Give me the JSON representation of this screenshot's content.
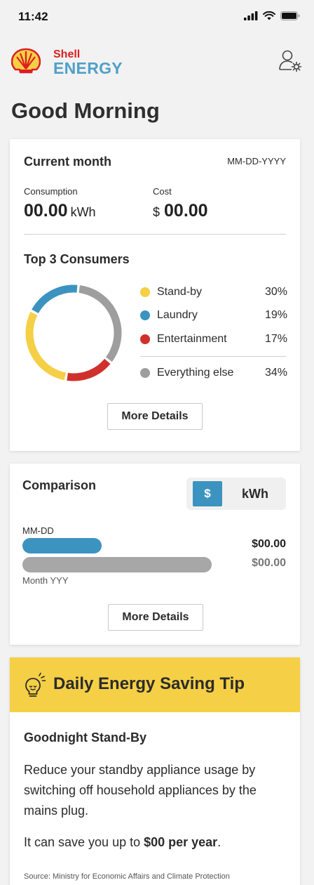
{
  "status_bar": {
    "time": "11:42"
  },
  "brand": {
    "top": "Shell",
    "bottom": "ENERGY",
    "primary_color": "#dd1d21",
    "accent_color": "#4fa0c9"
  },
  "greeting": "Good Morning",
  "current_month": {
    "title": "Current month",
    "date": "MM-DD-YYYY",
    "consumption_label": "Consumption",
    "consumption_value": "00.00",
    "consumption_unit": "kWh",
    "cost_label": "Cost",
    "cost_currency": "$",
    "cost_value": "00.00",
    "top_consumers_title": "Top 3 Consumers",
    "consumers": [
      {
        "label": "Stand-by",
        "percent": "30%",
        "value": 30,
        "color": "#f5cf45"
      },
      {
        "label": "Laundry",
        "percent": "19%",
        "value": 19,
        "color": "#3c93bf"
      },
      {
        "label": "Entertainment",
        "percent": "17%",
        "value": 17,
        "color": "#d0302c"
      },
      {
        "label": "Everything else",
        "percent": "34%",
        "value": 34,
        "color": "#9e9e9e"
      }
    ],
    "more_details": "More Details"
  },
  "comparison": {
    "title": "Comparison",
    "toggle_dollar": "$",
    "toggle_kwh": "kWh",
    "current_label": "MM-DD",
    "current_value": "$00.00",
    "current_fill": 0.42,
    "previous_label": "Month YYY",
    "previous_value": "$00.00",
    "previous_fill": 1.0,
    "more_details": "More Details"
  },
  "tip": {
    "title": "Daily Energy Saving Tip",
    "subtitle": "Goodnight Stand-By",
    "body": "Reduce your standby appliance usage by switching off household appliances by the mains plug.",
    "save_prefix": "It can save you up to ",
    "save_amount": "$00 per year",
    "save_suffix": ".",
    "source": "Source: Ministry for Economic Affairs and Climate Protection"
  }
}
